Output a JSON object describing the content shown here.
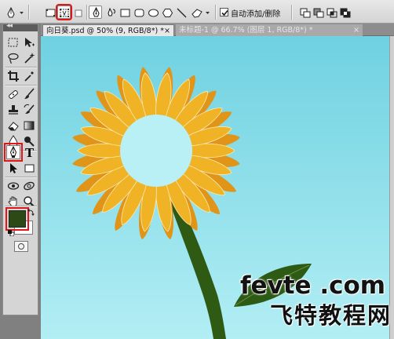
{
  "options_bar": {
    "tool_preset_icon": "pen-tool-icon",
    "mode_shape_layers_icon": "shape-layers-icon",
    "mode_paths_icon": "paths-icon",
    "mode_fill_pixels_icon": "fill-pixels-icon",
    "pen_icon": "pen-icon",
    "freeform_pen_icon": "freeform-pen-icon",
    "rectangle_icon": "rectangle-icon",
    "rounded_rectangle_icon": "rounded-rectangle-icon",
    "ellipse_icon": "ellipse-icon",
    "polygon_icon": "polygon-icon",
    "line_icon": "line-icon",
    "custom_shape_icon": "custom-shape-icon",
    "auto_add_delete": {
      "checked": true,
      "label": "自动添加/删除"
    },
    "path_ops_icons": [
      "add-to-path-icon",
      "subtract-path-icon",
      "intersect-path-icon",
      "exclude-path-icon"
    ],
    "highlight_color": "#e01616"
  },
  "tabs": [
    {
      "label": "向日葵.psd @ 50% (9, RGB/8*) *",
      "active": true
    },
    {
      "label": "未标题-1 @ 66.7% (图层 1, RGB/8*) *",
      "active": false
    }
  ],
  "tab_close_glyph": "×",
  "toolbox": {
    "collapse_glyph": "◂◂",
    "tools": [
      "marquee-icon",
      "move-icon",
      "lasso-icon",
      "magic-wand-icon",
      "crop-icon",
      "eyedropper-icon",
      "healing-brush-icon",
      "brush-icon",
      "clone-stamp-icon",
      "history-brush-icon",
      "eraser-icon",
      "gradient-icon",
      "blur-icon",
      "dodge-icon",
      "pen-icon",
      "type-icon",
      "path-selection-icon",
      "shape-icon",
      "3d-rotate-icon",
      "3d-orbit-icon",
      "hand-icon",
      "zoom-icon"
    ],
    "type_glyph": "T",
    "active_tool": "pen-icon",
    "foreground_color": "#2d4a16",
    "background_color": "#ffffff"
  },
  "canvas": {
    "sky_top": "#6fd1e1",
    "sky_bottom": "#b2eef4",
    "petal_color": "#f0b325",
    "petal_dark_color": "#e09418",
    "center_color": "#b8f0f5",
    "stem_color": "#2f5a14",
    "leaf_color": "#2d5a14"
  },
  "watermark": {
    "line1": "fevte .com",
    "line2": "飞特教程网"
  }
}
